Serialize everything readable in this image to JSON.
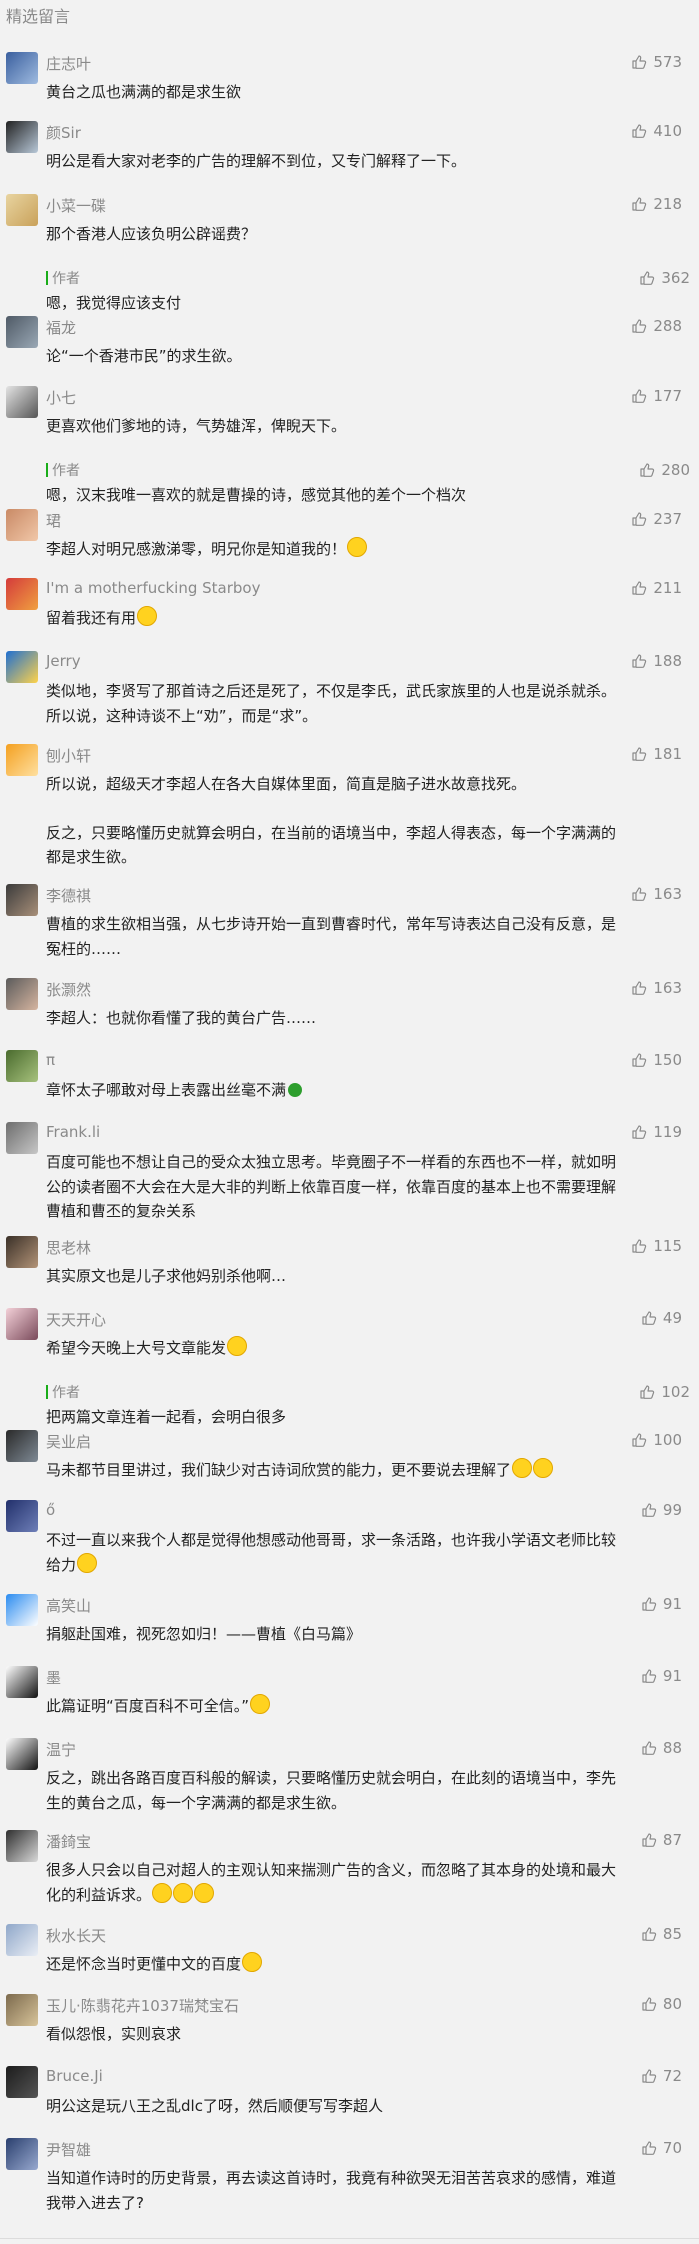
{
  "section_title": "精选留言",
  "comments": [
    {
      "author": "庄志叶",
      "likes": "573",
      "lines": [
        "黄台之瓜也满满的都是求生欲"
      ],
      "avatar_colors": [
        "#3a5f9e",
        "#9fbbe0"
      ]
    },
    {
      "author": "颜Sir",
      "likes": "410",
      "lines": [
        "明公是看大家对老李的广告的理解不到位，又专门解释了一下。"
      ],
      "avatar_colors": [
        "#222222",
        "#b8c8d8"
      ]
    },
    {
      "author": "小菜一碟",
      "likes": "218",
      "lines": [
        "那个香港人应该负明公辟谣费？"
      ],
      "avatar_colors": [
        "#e8d4a0",
        "#c9a15a"
      ],
      "reply": {
        "label": "作者",
        "likes": "362",
        "text": "嗯，我觉得应该支付"
      }
    },
    {
      "author": "福龙",
      "likes": "288",
      "lines": [
        "论“一个香港市民”的求生欲。"
      ],
      "avatar_colors": [
        "#4f5a66",
        "#9aa8b5"
      ]
    },
    {
      "author": "小七",
      "likes": "177",
      "lines": [
        "更喜欢他们爹地的诗，气势雄浑，俾睨天下。"
      ],
      "avatar_colors": [
        "#e4e4e4",
        "#555555"
      ],
      "reply": {
        "label": "作者",
        "likes": "280",
        "text": "嗯，汉末我唯一喜欢的就是曹操的诗，感觉其他的差个一个档次"
      }
    },
    {
      "author": "珺",
      "likes": "237",
      "lines": [
        "李超人对明兄感激涕零，明兄你是知道我的！"
      ],
      "emoji": 1,
      "avatar_colors": [
        "#c98a66",
        "#f1c7a8"
      ]
    },
    {
      "author": "I'm a motherfucking Starboy",
      "likes": "211",
      "lines": [
        "留着我还有用"
      ],
      "emoji": 1,
      "avatar_colors": [
        "#d43b3b",
        "#f0a040"
      ]
    },
    {
      "author": "Jerry",
      "likes": "188",
      "lines": [
        "类似地，李贤写了那首诗之后还是死了，不仅是李氏，武氏家族里的人也是说杀就杀。",
        "所以说，这种诗谈不上“劝”，而是“求”。"
      ],
      "avatar_colors": [
        "#1f6fd1",
        "#ffd34a"
      ]
    },
    {
      "author": "刨小轩",
      "likes": "181",
      "lines": [
        "所以说，超级天才李超人在各大自媒体里面，简直是脑子进水故意找死。"
      ],
      "paras": [
        [
          "反之，只要略懂历史就算会明白，在当前的语境当中，李超人得表态，每一个字满满的",
          "都是求生欲。"
        ]
      ],
      "avatar_colors": [
        "#f4a020",
        "#ffe0a0"
      ]
    },
    {
      "author": "李德祺",
      "likes": "163",
      "lines": [
        "曹植的求生欲相当强，从七步诗开始一直到曹睿时代，常年写诗表达自己没有反意，是",
        "冤枉的……"
      ],
      "avatar_colors": [
        "#3b3b3b",
        "#a9907a"
      ]
    },
    {
      "author": "张灏然",
      "likes": "163",
      "lines": [
        "李超人：也就你看懂了我的黄台广告……"
      ],
      "avatar_colors": [
        "#5b5b5b",
        "#d6b5a0"
      ]
    },
    {
      "author": "π",
      "likes": "150",
      "lines": [
        "章怀太子哪敢对母上表露出丝毫不满"
      ],
      "clover": true,
      "avatar_colors": [
        "#4a6b2e",
        "#a7c27d"
      ]
    },
    {
      "author": "Frank.li",
      "likes": "119",
      "lines": [
        "百度可能也不想让自己的受众太独立思考。毕竟圈子不一样看的东西也不一样，就如明",
        "公的读者圈不大会在大是大非的判断上依靠百度一样，依靠百度的基本上也不需要理解",
        "曹植和曹丕的复杂关系"
      ],
      "avatar_colors": [
        "#6d6d6d",
        "#c7c7c7"
      ]
    },
    {
      "author": "思老林",
      "likes": "115",
      "lines": [
        "其实原文也是儿子求他妈别杀他啊…"
      ],
      "avatar_colors": [
        "#3a3028",
        "#b39478"
      ]
    },
    {
      "author": "天天开心",
      "likes": "49",
      "lines": [
        "希望今天晚上大号文章能发"
      ],
      "emoji": 1,
      "avatar_colors": [
        "#f3d0d8",
        "#7a4a5a"
      ],
      "reply": {
        "label": "作者",
        "likes": "102",
        "text": "把两篇文章连着一起看，会明白很多"
      }
    },
    {
      "author": "吴业启",
      "likes": "100",
      "lines": [
        "马未都节目里讲过，我们缺少对古诗词欣赏的能力，更不要说去理解了"
      ],
      "emoji": 2,
      "avatar_colors": [
        "#2a2a2a",
        "#7f8a95"
      ]
    },
    {
      "author": "ő",
      "likes": "99",
      "lines": [
        "不过一直以来我个人都是觉得他想感动他哥哥，求一条活路，也许我小学语文老师比较",
        "给力"
      ],
      "emoji": 1,
      "avatar_colors": [
        "#22306b",
        "#6e7fb8"
      ]
    },
    {
      "author": "高笑山",
      "likes": "91",
      "lines": [
        "捐躯赴国难，视死忽如归！——曹植《白马篇》"
      ],
      "avatar_colors": [
        "#2b8cf0",
        "#ffffff"
      ]
    },
    {
      "author": "墨",
      "likes": "91",
      "lines": [
        "此篇证明“百度百科不可全信。”"
      ],
      "emoji": 1,
      "avatar_colors": [
        "#ffffff",
        "#111111"
      ]
    },
    {
      "author": "温宁",
      "likes": "88",
      "lines": [
        "反之，跳出各路百度百科般的解读，只要略懂历史就会明白，在此刻的语境当中，李先",
        "生的黄台之瓜，每一个字满满的都是求生欲。"
      ],
      "avatar_colors": [
        "#ffffff",
        "#111111"
      ]
    },
    {
      "author": "潘錡宝",
      "likes": "87",
      "lines": [
        "很多人只会以自己对超人的主观认知来揣测广告的含义，而忽略了其本身的处境和最大",
        "化的利益诉求。"
      ],
      "emoji": 3,
      "avatar_colors": [
        "#2f2f2f",
        "#d9d9d9"
      ]
    },
    {
      "author": "秋水长天",
      "likes": "85",
      "lines": [
        "还是怀念当时更懂中文的百度"
      ],
      "emoji": 1,
      "avatar_colors": [
        "#8fa7c9",
        "#eaeef5"
      ]
    },
    {
      "author": "玉儿·陈翡花卉1037瑞梵宝石",
      "likes": "80",
      "lines": [
        "看似怨恨，实则哀求"
      ],
      "avatar_colors": [
        "#7c6a4d",
        "#d8c49a"
      ]
    },
    {
      "author": "Bruce.Ji",
      "likes": "72",
      "lines": [
        "明公这是玩八王之乱dlc了呀，然后顺便写写李超人"
      ],
      "avatar_colors": [
        "#1c1c1c",
        "#555555"
      ]
    },
    {
      "author": "尹智雄",
      "likes": "70",
      "lines": [
        "当知道作诗时的历史背景，再去读这首诗时，我竟有种欲哭无泪苦苦哀求的感情，难道",
        "我带入进去了?"
      ],
      "avatar_colors": [
        "#2a3f6e",
        "#98a9cf"
      ]
    }
  ]
}
